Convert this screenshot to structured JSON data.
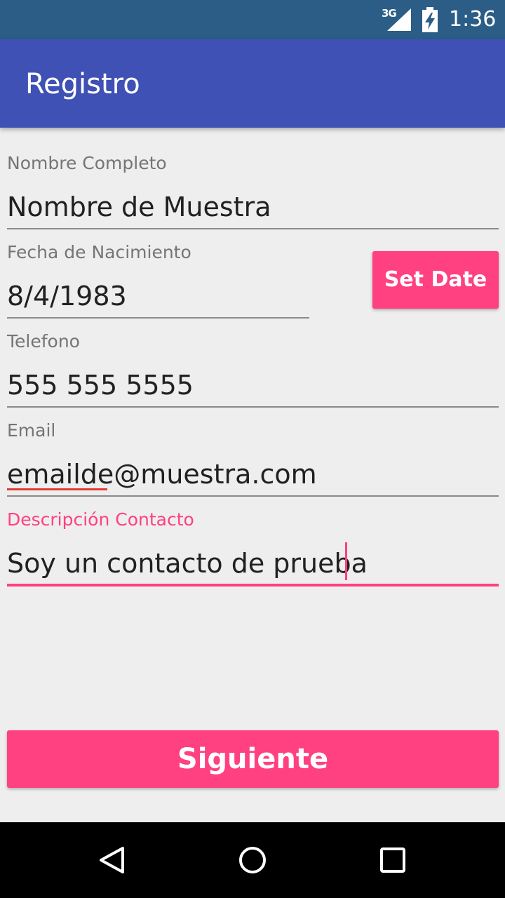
{
  "status_bar": {
    "network": "3G",
    "time": "1:36",
    "icons": [
      "signal-icon",
      "battery-charging-icon"
    ]
  },
  "app_bar": {
    "title": "Registro",
    "color": "#3f51b5"
  },
  "form": {
    "full_name": {
      "label": "Nombre Completo",
      "value": "Nombre de Muestra"
    },
    "birth_date": {
      "label": "Fecha de Nacimiento",
      "value": "8/4/1983",
      "button_label": "Set Date"
    },
    "phone": {
      "label": "Telefono",
      "value": "555 555 5555"
    },
    "email": {
      "label": "Email",
      "value": "emailde@muestra.com"
    },
    "description": {
      "label": "Descripción Contacto",
      "value": "Soy un contacto de prueba"
    }
  },
  "actions": {
    "next_label": "Siguiente"
  },
  "theme": {
    "accent": "#ff4081",
    "status_bar": "#2b5d86",
    "background": "#eeeeee"
  },
  "nav_bar": {
    "icons": [
      "back-icon",
      "home-icon",
      "recents-icon"
    ]
  }
}
